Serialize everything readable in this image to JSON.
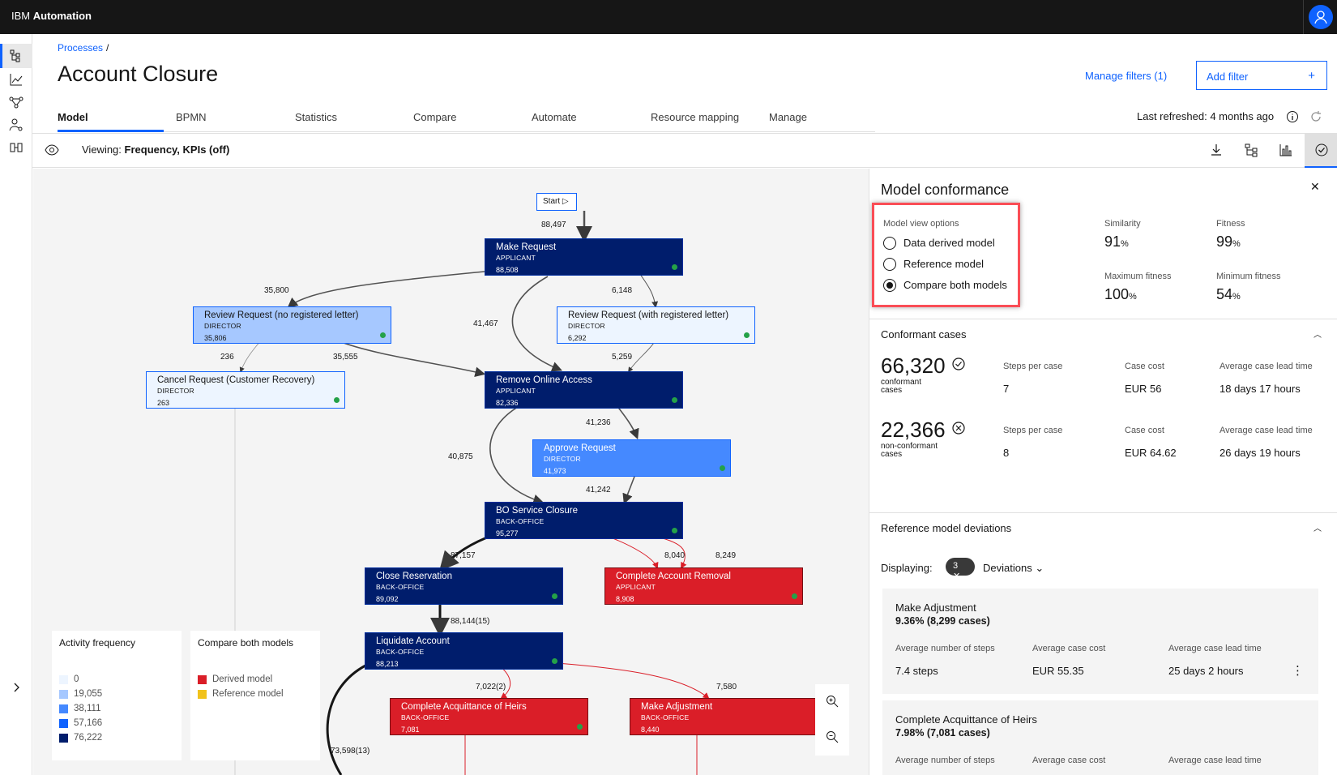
{
  "app": {
    "brand_prefix": "IBM",
    "brand_name": "Automation"
  },
  "breadcrumb": {
    "processes": "Processes",
    "separator": "/"
  },
  "page": {
    "title": "Account Closure"
  },
  "header": {
    "manage_filters": "Manage filters (1)",
    "add_filter": "Add filter",
    "add_icon": "+"
  },
  "tabs": [
    "Model",
    "BPMN",
    "Statistics",
    "Compare",
    "Automate",
    "Resource mapping",
    "Manage"
  ],
  "refresh": {
    "label": "Last refreshed:",
    "value": "4 months ago"
  },
  "toolbar": {
    "viewing_label": "Viewing:",
    "viewing_value": "Frequency, KPIs (off)"
  },
  "graph": {
    "start": "Start",
    "nodes": [
      {
        "title": "Make Request",
        "role": "APPLICANT",
        "count": "88,508"
      },
      {
        "title": "Review Request (no registered letter)",
        "role": "DIRECTOR",
        "count": "35,806"
      },
      {
        "title": "Review Request (with registered letter)",
        "role": "DIRECTOR",
        "count": "6,292"
      },
      {
        "title": "Cancel Request (Customer Recovery)",
        "role": "DIRECTOR",
        "count": "263"
      },
      {
        "title": "Remove Online Access",
        "role": "APPLICANT",
        "count": "82,336"
      },
      {
        "title": "Approve Request",
        "role": "DIRECTOR",
        "count": "41,973"
      },
      {
        "title": "BO Service Closure",
        "role": "BACK-OFFICE",
        "count": "95,277"
      },
      {
        "title": "Close Reservation",
        "role": "BACK-OFFICE",
        "count": "89,092"
      },
      {
        "title": "Complete Account Removal",
        "role": "APPLICANT",
        "count": "8,908"
      },
      {
        "title": "Liquidate Account",
        "role": "BACK-OFFICE",
        "count": "88,213"
      },
      {
        "title": "Complete Acquittance of Heirs",
        "role": "BACK-OFFICE",
        "count": "7,081"
      },
      {
        "title": "Make Adjustment",
        "role": "BACK-OFFICE",
        "count": "8,440"
      }
    ],
    "edges": [
      "88,497",
      "35,800",
      "6,148",
      "41,467",
      "236",
      "35,555",
      "5,259",
      "41,236",
      "40,875",
      "41,242",
      "87,157",
      "8,040",
      "8,249",
      "88,144(15)",
      "7,022(2)",
      "7,580",
      "73,598(13)"
    ]
  },
  "legend_frequency": {
    "title": "Activity frequency",
    "items": [
      {
        "label": "0",
        "color": "#edf5ff"
      },
      {
        "label": "19,055",
        "color": "#a6c8ff"
      },
      {
        "label": "38,111",
        "color": "#4589ff"
      },
      {
        "label": "57,166",
        "color": "#0f62fe"
      },
      {
        "label": "76,222",
        "color": "#001d6c"
      }
    ]
  },
  "legend_compare": {
    "title": "Compare both models",
    "items": [
      {
        "label": "Derived model",
        "color": "#da1e28"
      },
      {
        "label": "Reference model",
        "color": "#f1c21b"
      }
    ]
  },
  "panel": {
    "title": "Model conformance",
    "close": "✕",
    "view_options_label": "Model view options",
    "options": [
      {
        "label": "Data derived model",
        "selected": false
      },
      {
        "label": "Reference model",
        "selected": false
      },
      {
        "label": "Compare both models",
        "selected": true
      }
    ],
    "metrics": [
      {
        "label": "Similarity",
        "value": "91",
        "unit": "%"
      },
      {
        "label": "Fitness",
        "value": "99",
        "unit": "%"
      },
      {
        "label": "Maximum fitness",
        "value": "100",
        "unit": "%"
      },
      {
        "label": "Minimum fitness",
        "value": "54",
        "unit": "%"
      }
    ],
    "conformant": {
      "title": "Conformant cases",
      "rows": [
        {
          "value": "66,320",
          "sub1": "conformant",
          "sub2": "cases",
          "steps_label": "Steps per case",
          "steps": "7",
          "cost_label": "Case cost",
          "cost": "EUR 56",
          "lead_label": "Average case lead time",
          "lead": "18 days 17 hours",
          "icon": "check-circle-icon"
        },
        {
          "value": "22,366",
          "sub1": "non-conformant",
          "sub2": "cases",
          "steps_label": "Steps per case",
          "steps": "8",
          "cost_label": "Case cost",
          "cost": "EUR 64.62",
          "lead_label": "Average case lead time",
          "lead": "26 days 19 hours",
          "icon": "x-circle-icon"
        }
      ]
    },
    "deviations": {
      "title": "Reference model deviations",
      "displaying": "Displaying:",
      "count": "3",
      "selector": "Deviations",
      "cards": [
        {
          "title": "Make Adjustment",
          "summary": "9.36% (8,299 cases)",
          "steps_label": "Average number of steps",
          "steps": "7.4 steps",
          "cost_label": "Average case cost",
          "cost": "EUR 55.35",
          "lead_label": "Average case lead time",
          "lead": "25 days 2 hours"
        },
        {
          "title": "Complete Acquittance of Heirs",
          "summary": "7.98% (7,081 cases)",
          "steps_label": "Average number of steps",
          "cost_label": "Average case cost",
          "lead_label": "Average case lead time"
        }
      ]
    }
  }
}
